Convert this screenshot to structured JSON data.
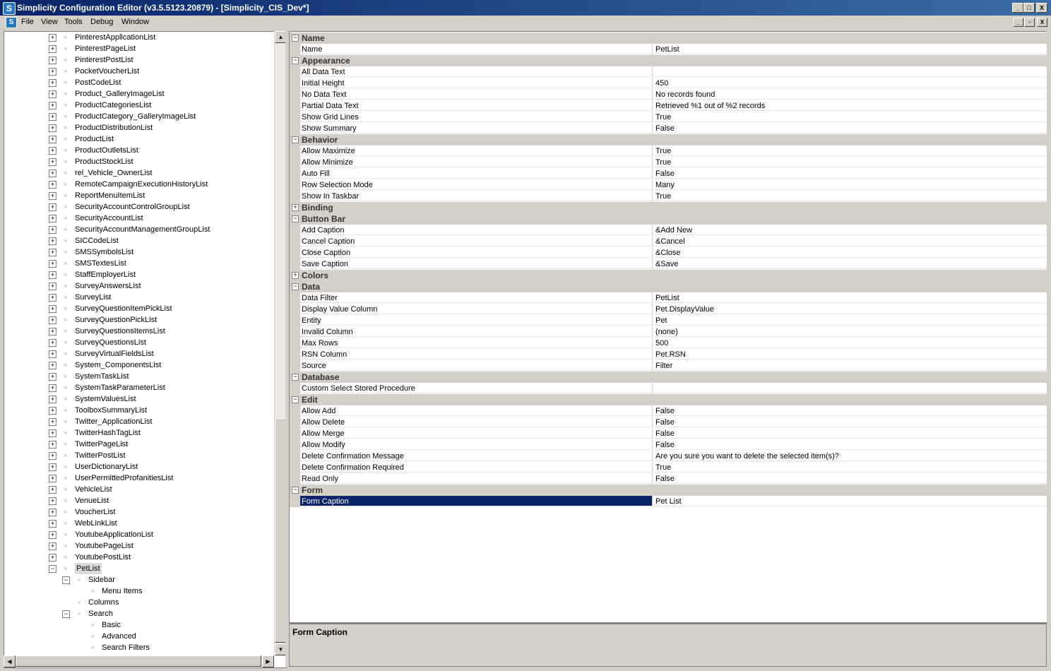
{
  "window": {
    "title": "Simplicity Configuration Editor (v3.5.5123.20879) - [Simplicity_CIS_Dev*]",
    "app_icon": "S",
    "minimize": "_",
    "maximize": "□",
    "close": "X"
  },
  "menu": {
    "items": [
      "File",
      "View",
      "Tools",
      "Debug",
      "Window"
    ],
    "mdi_minimize": "_",
    "mdi_restore": "▫",
    "mdi_close": "X"
  },
  "tree": {
    "items": [
      {
        "label": "PinterestApplicationList",
        "level": 1,
        "exp": "+"
      },
      {
        "label": "PinterestPageList",
        "level": 1,
        "exp": "+"
      },
      {
        "label": "PinterestPostList",
        "level": 1,
        "exp": "+"
      },
      {
        "label": "PocketVoucherList",
        "level": 1,
        "exp": "+"
      },
      {
        "label": "PostCodeList",
        "level": 1,
        "exp": "+"
      },
      {
        "label": "Product_GalleryImageList",
        "level": 1,
        "exp": "+"
      },
      {
        "label": "ProductCategoriesList",
        "level": 1,
        "exp": "+"
      },
      {
        "label": "ProductCategory_GalleryImageList",
        "level": 1,
        "exp": "+"
      },
      {
        "label": "ProductDistributionList",
        "level": 1,
        "exp": "+"
      },
      {
        "label": "ProductList",
        "level": 1,
        "exp": "+"
      },
      {
        "label": "ProductOutletsList",
        "level": 1,
        "exp": "+"
      },
      {
        "label": "ProductStockList",
        "level": 1,
        "exp": "+"
      },
      {
        "label": "rel_Vehicle_OwnerList",
        "level": 1,
        "exp": "+"
      },
      {
        "label": "RemoteCampaignExecutionHistoryList",
        "level": 1,
        "exp": "+"
      },
      {
        "label": "ReportMenuItemList",
        "level": 1,
        "exp": "+"
      },
      {
        "label": "SecurityAccountControlGroupList",
        "level": 1,
        "exp": "+"
      },
      {
        "label": "SecurityAccountList",
        "level": 1,
        "exp": "+"
      },
      {
        "label": "SecurityAccountManagementGroupList",
        "level": 1,
        "exp": "+"
      },
      {
        "label": "SICCodeList",
        "level": 1,
        "exp": "+"
      },
      {
        "label": "SMSSymbolsList",
        "level": 1,
        "exp": "+"
      },
      {
        "label": "SMSTextesList",
        "level": 1,
        "exp": "+"
      },
      {
        "label": "StaffEmployerList",
        "level": 1,
        "exp": "+"
      },
      {
        "label": "SurveyAnswersList",
        "level": 1,
        "exp": "+"
      },
      {
        "label": "SurveyList",
        "level": 1,
        "exp": "+"
      },
      {
        "label": "SurveyQuestionItemPickList",
        "level": 1,
        "exp": "+"
      },
      {
        "label": "SurveyQuestionPickList",
        "level": 1,
        "exp": "+"
      },
      {
        "label": "SurveyQuestionsItemsList",
        "level": 1,
        "exp": "+"
      },
      {
        "label": "SurveyQuestionsList",
        "level": 1,
        "exp": "+"
      },
      {
        "label": "SurveyVirtualFieldsList",
        "level": 1,
        "exp": "+"
      },
      {
        "label": "System_ComponentsList",
        "level": 1,
        "exp": "+"
      },
      {
        "label": "SystemTaskList",
        "level": 1,
        "exp": "+"
      },
      {
        "label": "SystemTaskParameterList",
        "level": 1,
        "exp": "+"
      },
      {
        "label": "SystemValuesList",
        "level": 1,
        "exp": "+"
      },
      {
        "label": "ToolboxSummaryList",
        "level": 1,
        "exp": "+"
      },
      {
        "label": "Twitter_ApplicationList",
        "level": 1,
        "exp": "+"
      },
      {
        "label": "TwitterHashTagList",
        "level": 1,
        "exp": "+"
      },
      {
        "label": "TwitterPageList",
        "level": 1,
        "exp": "+"
      },
      {
        "label": "TwitterPostList",
        "level": 1,
        "exp": "+"
      },
      {
        "label": "UserDictionaryList",
        "level": 1,
        "exp": "+"
      },
      {
        "label": "UserPermittedProfanitiesList",
        "level": 1,
        "exp": "+"
      },
      {
        "label": "VehicleList",
        "level": 1,
        "exp": "+"
      },
      {
        "label": "VenueList",
        "level": 1,
        "exp": "+"
      },
      {
        "label": "VoucherList",
        "level": 1,
        "exp": "+"
      },
      {
        "label": "WebLinkList",
        "level": 1,
        "exp": "+"
      },
      {
        "label": "YoutubeApplicationList",
        "level": 1,
        "exp": "+"
      },
      {
        "label": "YoutubePageList",
        "level": 1,
        "exp": "+"
      },
      {
        "label": "YoutubePostList",
        "level": 1,
        "exp": "+"
      },
      {
        "label": "PetList",
        "level": 1,
        "exp": "−",
        "selected": true
      },
      {
        "label": "Sidebar",
        "level": 2,
        "exp": "−"
      },
      {
        "label": "Menu Items",
        "level": 3,
        "exp": ""
      },
      {
        "label": "Columns",
        "level": 2,
        "exp": ""
      },
      {
        "label": "Search",
        "level": 2,
        "exp": "−"
      },
      {
        "label": "Basic",
        "level": 3,
        "exp": ""
      },
      {
        "label": "Advanced",
        "level": 3,
        "exp": ""
      },
      {
        "label": "Search Filters",
        "level": 3,
        "exp": ""
      }
    ]
  },
  "grid": {
    "rows": [
      {
        "type": "cat",
        "label": "Name",
        "exp": "−"
      },
      {
        "type": "prop",
        "name": "Name",
        "value": "PetList"
      },
      {
        "type": "cat",
        "label": "Appearance",
        "exp": "−"
      },
      {
        "type": "prop",
        "name": "All Data Text",
        "value": ""
      },
      {
        "type": "prop",
        "name": "Initial Height",
        "value": "450"
      },
      {
        "type": "prop",
        "name": "No Data Text",
        "value": "No records found"
      },
      {
        "type": "prop",
        "name": "Partial Data Text",
        "value": "Retrieved %1 out of %2 records"
      },
      {
        "type": "prop",
        "name": "Show Grid Lines",
        "value": "True"
      },
      {
        "type": "prop",
        "name": "Show Summary",
        "value": "False"
      },
      {
        "type": "cat",
        "label": "Behavior",
        "exp": "−"
      },
      {
        "type": "prop",
        "name": "Allow Maximize",
        "value": "True"
      },
      {
        "type": "prop",
        "name": "Allow Minimize",
        "value": "True"
      },
      {
        "type": "prop",
        "name": "Auto Fill",
        "value": "False"
      },
      {
        "type": "prop",
        "name": "Row Selection Mode",
        "value": "Many"
      },
      {
        "type": "prop",
        "name": "Show In Taskbar",
        "value": "True"
      },
      {
        "type": "cat",
        "label": "Binding",
        "exp": "+"
      },
      {
        "type": "cat",
        "label": "Button Bar",
        "exp": "−"
      },
      {
        "type": "prop",
        "name": "Add Caption",
        "value": "&Add New"
      },
      {
        "type": "prop",
        "name": "Cancel Caption",
        "value": "&Cancel"
      },
      {
        "type": "prop",
        "name": "Close Caption",
        "value": "&Close"
      },
      {
        "type": "prop",
        "name": "Save Caption",
        "value": "&Save"
      },
      {
        "type": "cat",
        "label": "Colors",
        "exp": "+"
      },
      {
        "type": "cat",
        "label": "Data",
        "exp": "−"
      },
      {
        "type": "prop",
        "name": "Data Filter",
        "value": "PetList"
      },
      {
        "type": "prop",
        "name": "Display Value Column",
        "value": "Pet.DisplayValue"
      },
      {
        "type": "prop",
        "name": "Entity",
        "value": "Pet"
      },
      {
        "type": "prop",
        "name": "Invalid Column",
        "value": "(none)"
      },
      {
        "type": "prop",
        "name": "Max Rows",
        "value": "500"
      },
      {
        "type": "prop",
        "name": "RSN Column",
        "value": "Pet.RSN"
      },
      {
        "type": "prop",
        "name": "Source",
        "value": "Filter"
      },
      {
        "type": "cat",
        "label": "Database",
        "exp": "−"
      },
      {
        "type": "prop",
        "name": "Custom Select Stored Procedure",
        "value": ""
      },
      {
        "type": "cat",
        "label": "Edit",
        "exp": "−"
      },
      {
        "type": "prop",
        "name": "Allow Add",
        "value": "False"
      },
      {
        "type": "prop",
        "name": "Allow Delete",
        "value": "False"
      },
      {
        "type": "prop",
        "name": "Allow Merge",
        "value": "False"
      },
      {
        "type": "prop",
        "name": "Allow Modify",
        "value": "False"
      },
      {
        "type": "prop",
        "name": "Delete Confirmation Message",
        "value": "Are you sure you want to delete the selected item(s)?"
      },
      {
        "type": "prop",
        "name": "Delete Confirmation Required",
        "value": "True"
      },
      {
        "type": "prop",
        "name": "Read Only",
        "value": "False"
      },
      {
        "type": "cat",
        "label": "Form",
        "exp": "−"
      },
      {
        "type": "prop",
        "name": "Form Caption",
        "value": "Pet List",
        "selected": true
      }
    ]
  },
  "description": {
    "title": "Form Caption"
  },
  "scroll": {
    "up": "▲",
    "down": "▼",
    "left": "◀",
    "right": "▶"
  }
}
